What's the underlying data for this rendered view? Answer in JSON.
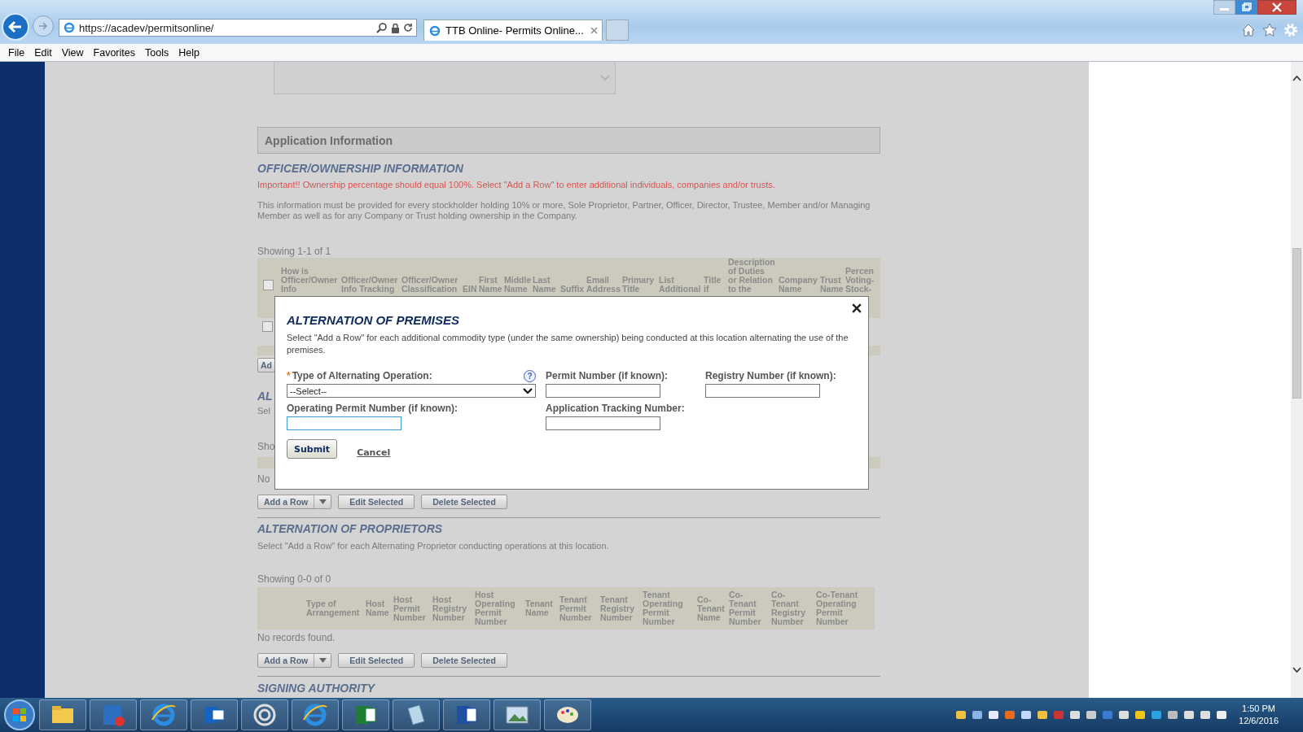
{
  "browser": {
    "address": "https://acadev/permitsonline/",
    "tab_title": "TTB Online- Permits Online...",
    "menu": [
      "File",
      "Edit",
      "View",
      "Favorites",
      "Tools",
      "Help"
    ]
  },
  "page": {
    "section_title": "Application Information",
    "officer": {
      "heading": "OFFICER/OWNERSHIP INFORMATION",
      "notice": "Important!! Ownership percentage should equal 100%. Select \"Add a Row\" to enter additional individuals, companies and/or trusts.",
      "description": "This information must be provided for every stockholder holding 10% or more, Sole Proprietor, Partner, Officer, Director, Trustee, Member and/or Managing Member as well as for any Company or Trust holding ownership in the Company.",
      "showing": "Showing 1-1 of 1",
      "select_all_checked": false,
      "columns": [
        "How is\nOfficer/Owner\nInfo",
        "Officer/Owner\nInfo Tracking",
        "Officer/Owner\nClassification",
        "EIN",
        "First\nName",
        "Middle\nName",
        "Last\nName",
        "Suffix",
        "Email\nAddress",
        "Primary\nTitle",
        "List\nAdditional",
        "Title\nif",
        "Description\nof Duties\nor Relation\nto the",
        "Company\nName",
        "Trust\nName",
        "Percen\nVoting-\nStock-"
      ],
      "rows": [
        {
          "checked": false
        }
      ],
      "covered_button": "Ad"
    },
    "premises": {
      "heading": "AL",
      "description": "Sel",
      "showing": "Sho",
      "empty": "No",
      "buttons": {
        "add": "Add a Row",
        "edit": "Edit Selected",
        "delete": "Delete Selected"
      }
    },
    "proprietors": {
      "heading": "ALTERNATION OF PROPRIETORS",
      "description": "Select \"Add a Row\" for each Alternating Proprietor conducting operations at this location.",
      "showing": "Showing 0-0 of 0",
      "columns": [
        "",
        "Type of\nArrangement",
        "Host\nName",
        "Host\nPermit\nNumber",
        "Host\nRegistry\nNumber",
        "Host\nOperating\nPermit\nNumber",
        "Tenant\nName",
        "Tenant\nPermit\nNumber",
        "Tenant\nRegistry\nNumber",
        "Tenant\nOperating\nPermit\nNumber",
        "Co-\nTenant\nName",
        "Co-\nTenant\nPermit\nNumber",
        "Co-\nTenant\nRegistry\nNumber",
        "Co-Tenant\nOperating\nPermit\nNumber"
      ],
      "empty": "No records found.",
      "buttons": {
        "add": "Add a Row",
        "edit": "Edit Selected",
        "delete": "Delete Selected"
      }
    },
    "signing_heading": "SIGNING AUTHORITY"
  },
  "modal": {
    "title": "ALTERNATION OF PREMISES",
    "description": "Select \"Add a Row\" for each additional commodity type (under the same ownership) being conducted at this location alternating the use of the premises.",
    "fields": [
      {
        "kind": "select",
        "marker": "*",
        "label": "Type of Alternating Operation:",
        "help": "?",
        "value": "--Select--",
        "focused": false
      },
      {
        "kind": "text",
        "label": "Permit Number (if known):",
        "focused": false
      },
      {
        "kind": "text",
        "label": "Registry Number (if known):",
        "focused": false
      },
      {
        "kind": "text",
        "label": "Operating Permit Number (if known):",
        "focused": true
      },
      {
        "kind": "text",
        "label": "Application Tracking Number:",
        "focused": false
      }
    ],
    "submit": "Submit",
    "cancel": "Cancel"
  },
  "taskbar": {
    "time": "1:50 PM",
    "date": "12/6/2016"
  }
}
